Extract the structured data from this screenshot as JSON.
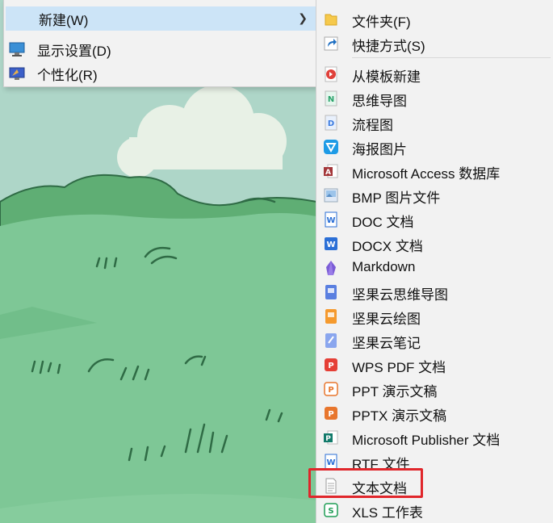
{
  "context_menu": {
    "items": [
      {
        "label": "新建(W)",
        "icon": "folder-new-icon",
        "has_submenu": true
      },
      {
        "label": "显示设置(D)",
        "icon": "display-settings-icon"
      },
      {
        "label": "个性化(R)",
        "icon": "personalize-icon"
      }
    ]
  },
  "submenu": {
    "items": [
      {
        "label": "文件夹(F)",
        "icon": "folder-icon"
      },
      {
        "label": "快捷方式(S)",
        "icon": "shortcut-icon"
      },
      {
        "label": "从模板新建",
        "icon": "template-icon"
      },
      {
        "label": "思维导图",
        "icon": "mindmap-icon"
      },
      {
        "label": "流程图",
        "icon": "flowchart-icon"
      },
      {
        "label": "海报图片",
        "icon": "poster-icon"
      },
      {
        "label": "Microsoft Access 数据库",
        "icon": "access-icon"
      },
      {
        "label": "BMP 图片文件",
        "icon": "bmp-icon"
      },
      {
        "label": "DOC 文档",
        "icon": "doc-icon"
      },
      {
        "label": "DOCX 文档",
        "icon": "docx-icon"
      },
      {
        "label": "Markdown",
        "icon": "markdown-icon"
      },
      {
        "label": "坚果云思维导图",
        "icon": "jianguoyun-mindmap-icon"
      },
      {
        "label": "坚果云绘图",
        "icon": "jianguoyun-drawing-icon"
      },
      {
        "label": "坚果云笔记",
        "icon": "jianguoyun-note-icon"
      },
      {
        "label": "WPS PDF 文档",
        "icon": "wps-pdf-icon"
      },
      {
        "label": "PPT 演示文稿",
        "icon": "ppt-icon"
      },
      {
        "label": "PPTX 演示文稿",
        "icon": "pptx-icon"
      },
      {
        "label": "Microsoft Publisher 文档",
        "icon": "publisher-icon"
      },
      {
        "label": "RTF 文件",
        "icon": "rtf-icon"
      },
      {
        "label": "文本文档",
        "icon": "text-document-icon",
        "highlighted": true
      },
      {
        "label": "XLS 工作表",
        "icon": "xls-icon"
      }
    ]
  },
  "colors": {
    "menu_bg": "#f2f2f2",
    "hover_bg": "#cce4f7",
    "highlight_border": "#e0262b",
    "wallpaper_green": "#6fbf86"
  }
}
